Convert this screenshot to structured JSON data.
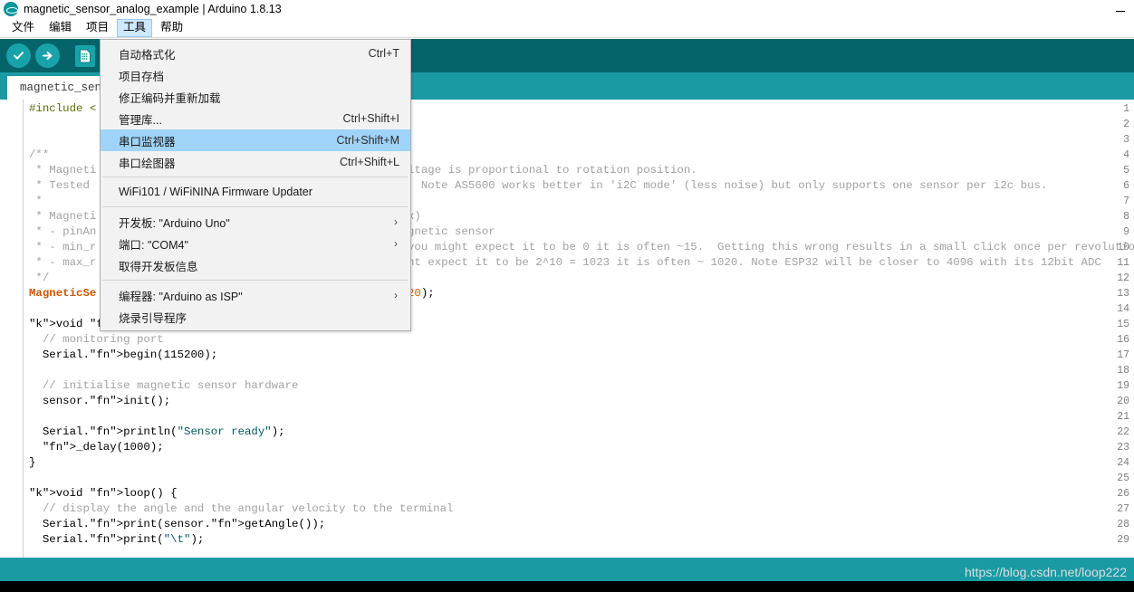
{
  "window": {
    "title": "magnetic_sensor_analog_example | Arduino 1.8.13",
    "icon": "arduino-logo-icon",
    "minimize_label": "—"
  },
  "menubar": {
    "items": [
      {
        "label": "文件",
        "active": false
      },
      {
        "label": "编辑",
        "active": false
      },
      {
        "label": "项目",
        "active": false
      },
      {
        "label": "工具",
        "active": true
      },
      {
        "label": "帮助",
        "active": false
      }
    ]
  },
  "toolbar": {
    "buttons": [
      {
        "name": "verify-button",
        "icon": "check-icon"
      },
      {
        "name": "upload-button",
        "icon": "arrow-right-icon"
      },
      {
        "name": "new-sketch-button",
        "icon": "new-document-icon"
      },
      {
        "name": "open-sketch-button",
        "icon": "open-folder-icon"
      }
    ]
  },
  "tabs": [
    {
      "label": "magnetic_sen"
    }
  ],
  "tools_menu": {
    "items": [
      {
        "type": "item",
        "label": "自动格式化",
        "accel": "Ctrl+T",
        "selected": false,
        "submenu": false
      },
      {
        "type": "item",
        "label": "项目存档",
        "accel": "",
        "selected": false,
        "submenu": false
      },
      {
        "type": "item",
        "label": "修正编码并重新加载",
        "accel": "",
        "selected": false,
        "submenu": false
      },
      {
        "type": "item",
        "label": "管理库...",
        "accel": "Ctrl+Shift+I",
        "selected": false,
        "submenu": false
      },
      {
        "type": "item",
        "label": "串口监视器",
        "accel": "Ctrl+Shift+M",
        "selected": true,
        "submenu": false
      },
      {
        "type": "item",
        "label": "串口绘图器",
        "accel": "Ctrl+Shift+L",
        "selected": false,
        "submenu": false
      },
      {
        "type": "separator"
      },
      {
        "type": "item",
        "label": "WiFi101 / WiFiNINA Firmware Updater",
        "accel": "",
        "selected": false,
        "submenu": false
      },
      {
        "type": "separator"
      },
      {
        "type": "item",
        "label": "开发板: \"Arduino Uno\"",
        "accel": "",
        "selected": false,
        "submenu": true
      },
      {
        "type": "item",
        "label": "端口: \"COM4\"",
        "accel": "",
        "selected": false,
        "submenu": true
      },
      {
        "type": "item",
        "label": "取得开发板信息",
        "accel": "",
        "selected": false,
        "submenu": false
      },
      {
        "type": "separator"
      },
      {
        "type": "item",
        "label": "编程器: \"Arduino as ISP\"",
        "accel": "",
        "selected": false,
        "submenu": true
      },
      {
        "type": "item",
        "label": "烧录引导程序",
        "accel": "",
        "selected": false,
        "submenu": false
      }
    ],
    "submenu_arrow": "›"
  },
  "editor": {
    "line_numbers": [
      1,
      2,
      3,
      4,
      5,
      6,
      7,
      8,
      9,
      10,
      11,
      12,
      13,
      14,
      15,
      16,
      17,
      18,
      19,
      20,
      21,
      22,
      23,
      24,
      25,
      26,
      27,
      28,
      29
    ],
    "lines": [
      "#include <",
      "",
      "",
      "/**",
      " * Magneti",
      " * Tested",
      " *",
      " * Magneti",
      " * - pinAn",
      " * - min_r",
      " * - max_r",
      " */",
      "MagneticSe",
      "",
      "void setup() {",
      "  // monitoring port",
      "  Serial.begin(115200);",
      "",
      "  // initialise magnetic sensor hardware",
      "  sensor.init();",
      "",
      "  Serial.println(\"Sensor ready\");",
      "  _delay(1000);",
      "}",
      "",
      "void loop() {",
      "  // display the angle and the angular velocity to the terminal",
      "  Serial.print(sensor.getAngle());",
      "  Serial.print(\"\\t\");"
    ],
    "right_fragments": [
      {
        "line": 5,
        "text": "ltage is proportional to rotation position."
      },
      {
        "line": 6,
        "text": "  Note AS5600 works better in 'i2C mode' (less noise) but only supports one sensor per i2c bus."
      },
      {
        "line": 8,
        "text": "x)"
      },
      {
        "line": 9,
        "text": "gnetic sensor"
      },
      {
        "line": 10,
        "text": "you might expect it to be 0 it is often ~15.  Getting this wrong results in a small click once per revolution"
      },
      {
        "line": 11,
        "text": "ht expect it to be 2^10 = 1023 it is often ~ 1020. Note ESP32 will be closer to 4096 with its 12bit ADC"
      },
      {
        "line": 13,
        "text": "20);"
      }
    ]
  },
  "status": {
    "watermark": "https://blog.csdn.net/loop222"
  },
  "colors": {
    "toolbar": "#05646a",
    "tabstrip": "#1a9ba4",
    "statusbar": "#1a9ba4",
    "menu_selection": "#9fd3f7",
    "menubar_active": "#cde8ff",
    "accent_icon": "#18a3aa"
  }
}
